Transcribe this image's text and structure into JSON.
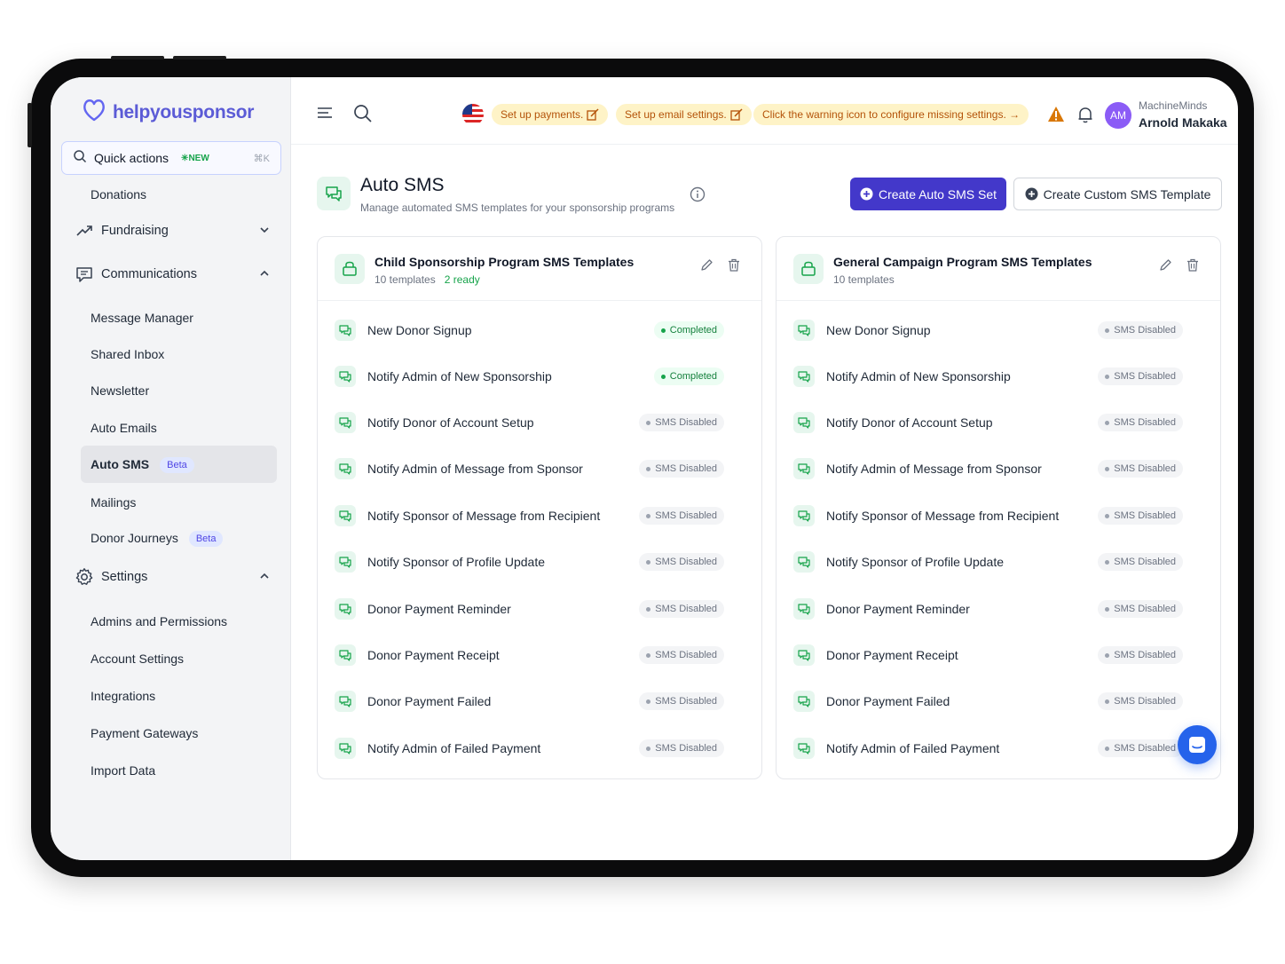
{
  "app": {
    "logo_text": "helpyousponsor"
  },
  "sidebar": {
    "quick_actions": {
      "label": "Quick actions",
      "badge": "NEW",
      "shortcut": "⌘K"
    },
    "donations": "Donations",
    "fundraising": "Fundraising",
    "communications": "Communications",
    "comm_items": [
      {
        "label": "Message Manager"
      },
      {
        "label": "Shared Inbox"
      },
      {
        "label": "Newsletter"
      },
      {
        "label": "Auto Emails"
      },
      {
        "label": "Auto SMS",
        "badge": "Beta"
      },
      {
        "label": "Mailings"
      },
      {
        "label": "Donor Journeys",
        "badge": "Beta"
      }
    ],
    "settings": "Settings",
    "settings_items": [
      {
        "label": "Admins and Permissions"
      },
      {
        "label": "Account Settings"
      },
      {
        "label": "Integrations"
      },
      {
        "label": "Payment Gateways"
      },
      {
        "label": "Import Data"
      }
    ]
  },
  "topbar": {
    "pills": [
      {
        "label": "Set up payments."
      },
      {
        "label": "Set up email settings."
      },
      {
        "label": "Click the warning icon to configure missing settings. →"
      }
    ],
    "user": {
      "initials": "AM",
      "org": "MachineMinds",
      "name": "Arnold Makaka"
    }
  },
  "header": {
    "title": "Auto SMS",
    "subtitle": "Manage automated SMS templates for your sponsorship programs",
    "primary_button": "Create Auto SMS Set",
    "secondary_button": "Create Custom SMS Template"
  },
  "colors": {
    "accent": "#4338ca",
    "success": "#16a34a",
    "warning": "#d97706"
  },
  "cards": [
    {
      "title": "Child Sponsorship Program SMS Templates",
      "count": "10 templates",
      "ready": "2 ready",
      "rows": [
        {
          "label": "New Donor Signup",
          "status": "Completed",
          "state": "done"
        },
        {
          "label": "Notify Admin of New Sponsorship",
          "status": "Completed",
          "state": "done"
        },
        {
          "label": "Notify Donor of Account Setup",
          "status": "SMS Disabled",
          "state": "off"
        },
        {
          "label": "Notify Admin of Message from Sponsor",
          "status": "SMS Disabled",
          "state": "off"
        },
        {
          "label": "Notify Sponsor of Message from Recipient",
          "status": "SMS Disabled",
          "state": "off"
        },
        {
          "label": "Notify Sponsor of Profile Update",
          "status": "SMS Disabled",
          "state": "off"
        },
        {
          "label": "Donor Payment Reminder",
          "status": "SMS Disabled",
          "state": "off"
        },
        {
          "label": "Donor Payment Receipt",
          "status": "SMS Disabled",
          "state": "off"
        },
        {
          "label": "Donor Payment Failed",
          "status": "SMS Disabled",
          "state": "off"
        },
        {
          "label": "Notify Admin of Failed Payment",
          "status": "SMS Disabled",
          "state": "off"
        }
      ]
    },
    {
      "title": "General Campaign Program SMS Templates",
      "count": "10 templates",
      "ready": "",
      "rows": [
        {
          "label": "New Donor Signup",
          "status": "SMS Disabled",
          "state": "off"
        },
        {
          "label": "Notify Admin of New Sponsorship",
          "status": "SMS Disabled",
          "state": "off"
        },
        {
          "label": "Notify Donor of Account Setup",
          "status": "SMS Disabled",
          "state": "off"
        },
        {
          "label": "Notify Admin of Message from Sponsor",
          "status": "SMS Disabled",
          "state": "off"
        },
        {
          "label": "Notify Sponsor of Message from Recipient",
          "status": "SMS Disabled",
          "state": "off"
        },
        {
          "label": "Notify Sponsor of Profile Update",
          "status": "SMS Disabled",
          "state": "off"
        },
        {
          "label": "Donor Payment Reminder",
          "status": "SMS Disabled",
          "state": "off"
        },
        {
          "label": "Donor Payment Receipt",
          "status": "SMS Disabled",
          "state": "off"
        },
        {
          "label": "Donor Payment Failed",
          "status": "SMS Disabled",
          "state": "off"
        },
        {
          "label": "Notify Admin of Failed Payment",
          "status": "SMS Disabled",
          "state": "off"
        }
      ]
    }
  ]
}
